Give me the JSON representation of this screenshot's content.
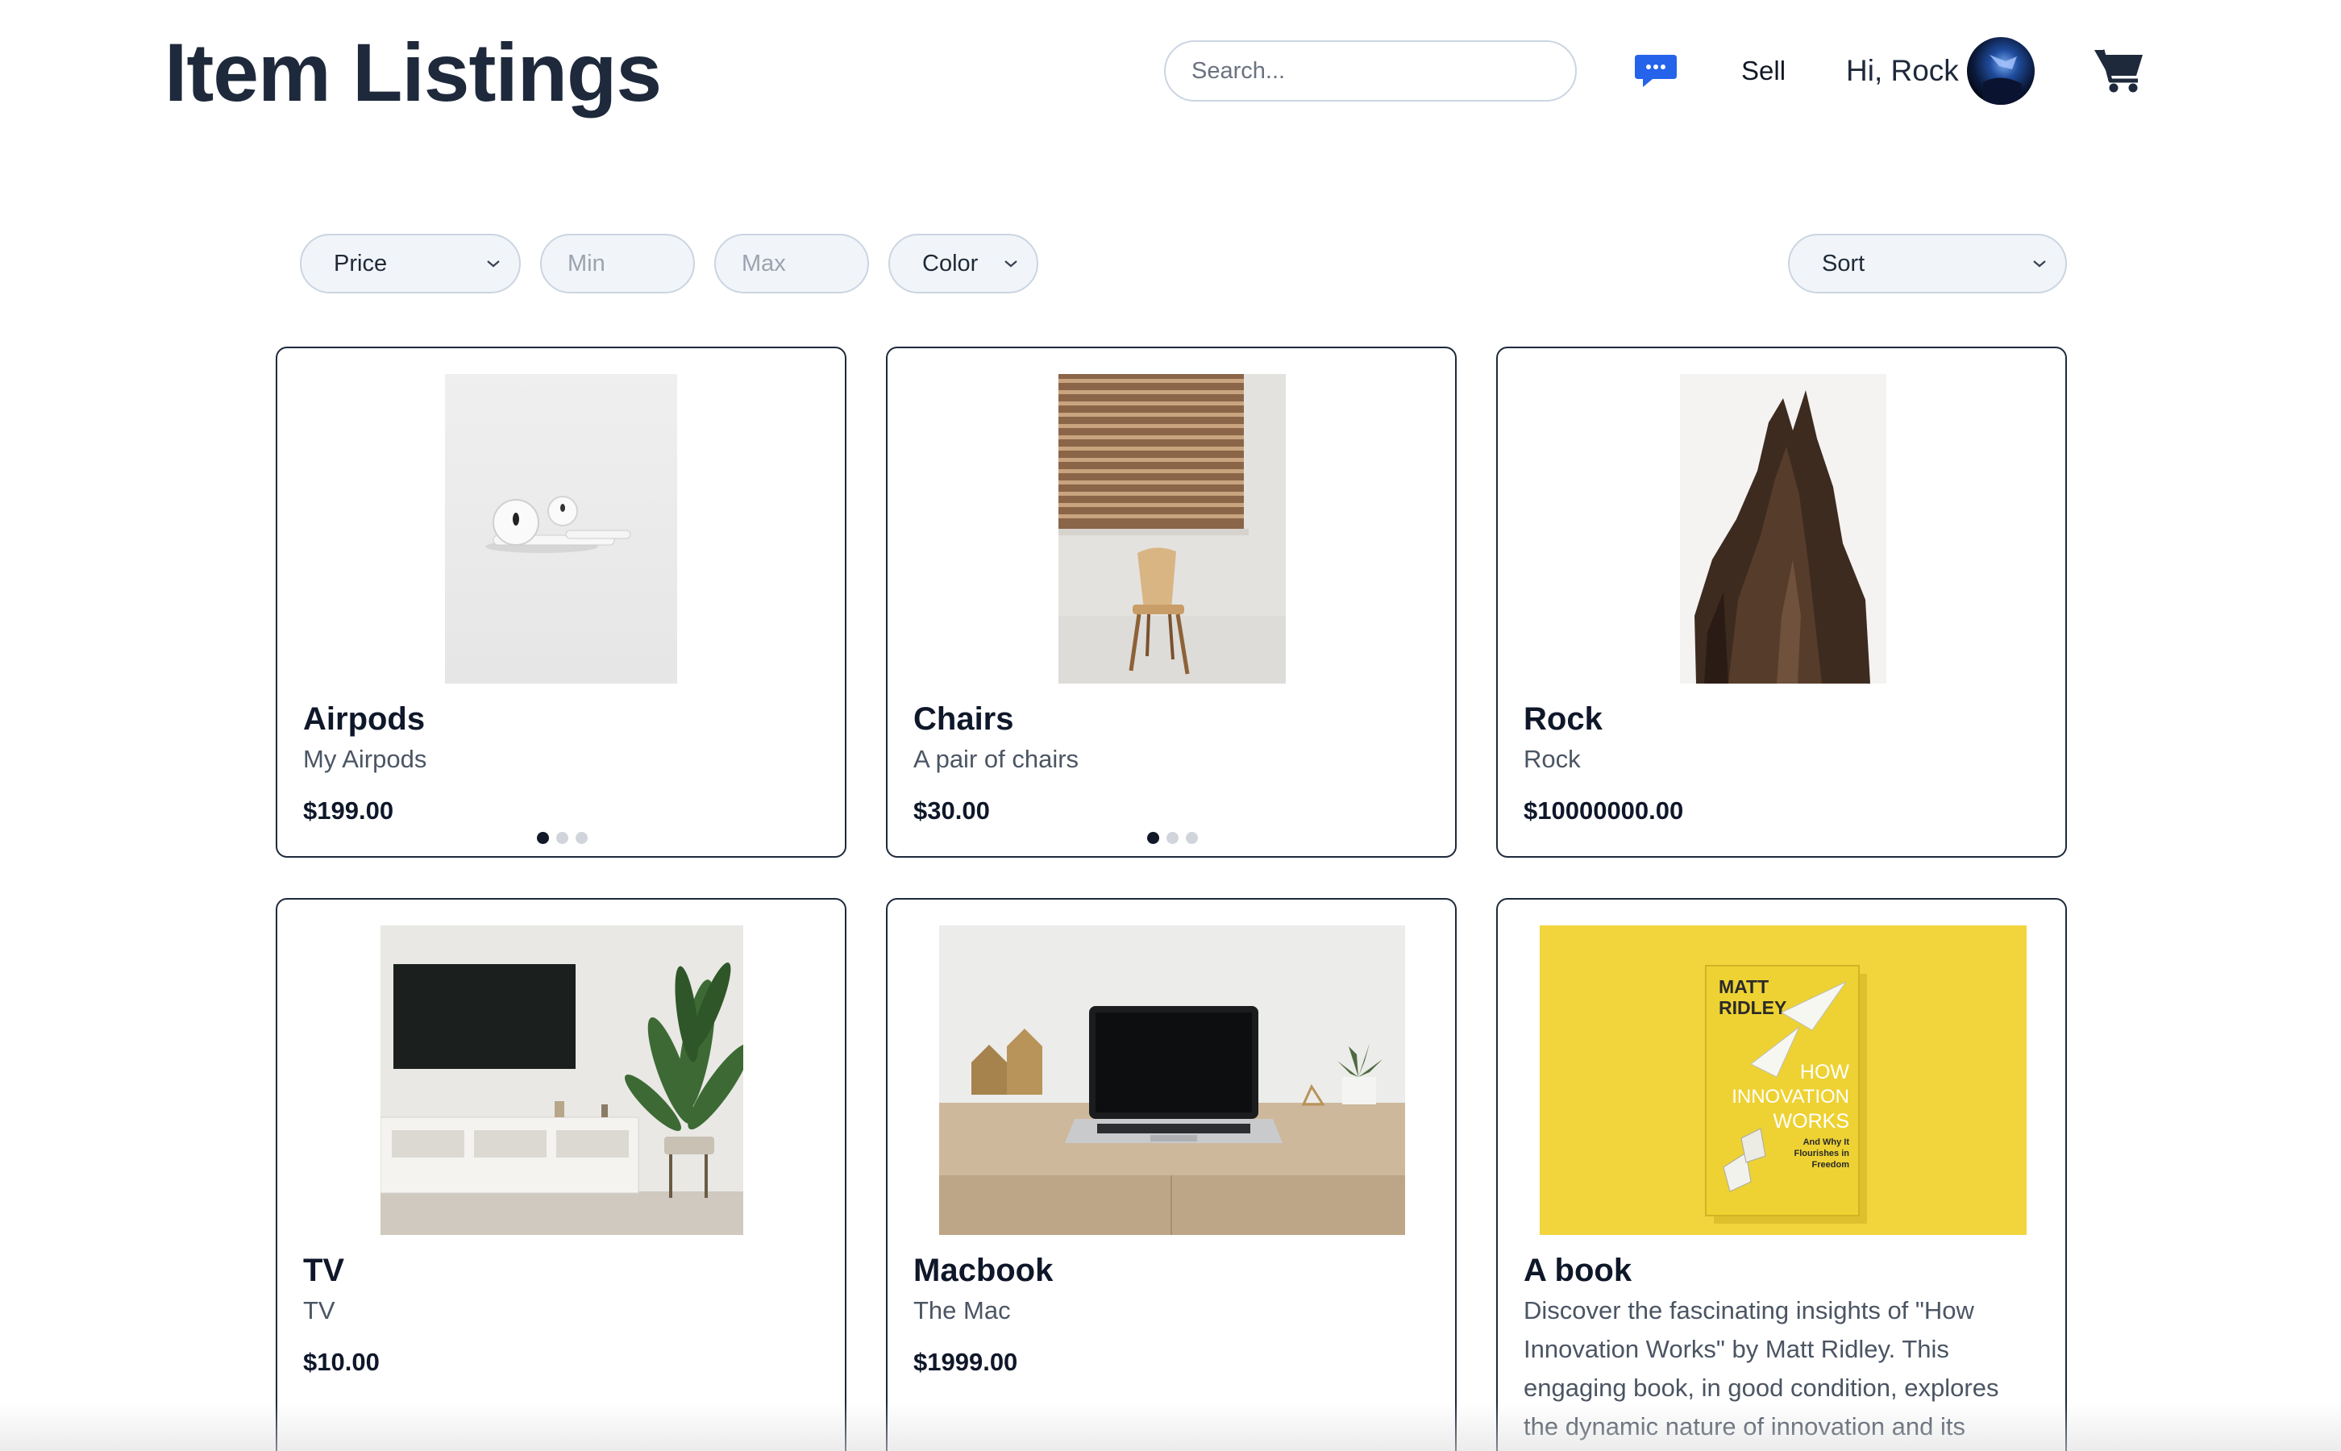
{
  "header": {
    "title": "Item Listings",
    "search_placeholder": "Search...",
    "chat_icon": "chat-bubble-icon",
    "sell_label": "Sell",
    "greeting": "Hi, Rock",
    "cart_icon": "shopping-cart-icon"
  },
  "filters": {
    "price_label": "Price",
    "min_placeholder": "Min",
    "max_placeholder": "Max",
    "color_label": "Color",
    "sort_label": "Sort"
  },
  "colors": {
    "title": "#1e293b",
    "chat_icon": "#2563eb",
    "card_border": "#1e293b",
    "input_bg": "#f1f5f9",
    "book_yellow": "#f2d43d"
  },
  "listings": [
    {
      "name": "Airpods",
      "description": "My Airpods",
      "price": "$199.00",
      "images": 3,
      "active_image": 1
    },
    {
      "name": "Chairs",
      "description": "A pair of chairs",
      "price": "$30.00",
      "images": 3,
      "active_image": 1
    },
    {
      "name": "Rock",
      "description": "Rock",
      "price": "$10000000.00"
    },
    {
      "name": "TV",
      "description": "TV",
      "price": "$10.00"
    },
    {
      "name": "Macbook",
      "description": "The Mac",
      "price": "$1999.00"
    },
    {
      "name": "A book",
      "description": "Discover the fascinating insights of \"How Innovation Works\" by Matt Ridley. This engaging book, in good condition, explores the dynamic nature of innovation and its",
      "price": "",
      "book_cover": {
        "author_line1": "MATT",
        "author_line2": "RIDLEY",
        "title_line1": "HOW",
        "title_line2": "INNOVATION",
        "title_line3": "WORKS",
        "subtitle_line1": "And Why It",
        "subtitle_line2": "Flourishes in",
        "subtitle_line3": "Freedom"
      }
    }
  ]
}
